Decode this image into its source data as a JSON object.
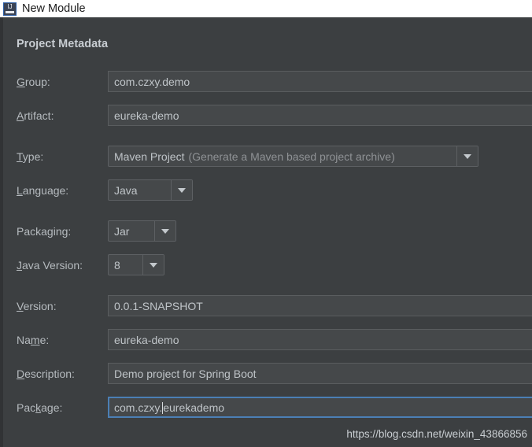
{
  "window": {
    "title": "New Module",
    "icon": "intellij-idea-icon",
    "icon_letters": "IJ"
  },
  "dialog": {
    "section_title": "Project Metadata",
    "fields": [
      {
        "id": "group",
        "kind": "text",
        "label_pre": "",
        "label_mnemonic": "G",
        "label_post": "roup:",
        "value": "com.czxy.demo",
        "focused": false
      },
      {
        "id": "artifact",
        "kind": "text",
        "label_pre": "",
        "label_mnemonic": "A",
        "label_post": "rtifact:",
        "value": "eureka-demo",
        "focused": false
      },
      {
        "id": "type",
        "kind": "combo",
        "label_pre": "",
        "label_mnemonic": "T",
        "label_post": "ype:",
        "value": "Maven Project",
        "value_dim": "(Generate a Maven based project archive)"
      },
      {
        "id": "language",
        "kind": "combo",
        "label_pre": "",
        "label_mnemonic": "L",
        "label_post": "anguage:",
        "value": "Java",
        "value_dim": ""
      },
      {
        "id": "packaging",
        "kind": "combo",
        "label_pre": "Packa",
        "label_mnemonic": "g",
        "label_post": "ing:",
        "value": "Jar",
        "value_dim": ""
      },
      {
        "id": "java-version",
        "kind": "combo",
        "label_pre": "",
        "label_mnemonic": "J",
        "label_post": "ava Version:",
        "value": "8",
        "value_dim": ""
      },
      {
        "id": "version",
        "kind": "text",
        "label_pre": "",
        "label_mnemonic": "V",
        "label_post": "ersion:",
        "value": "0.0.1-SNAPSHOT",
        "focused": false
      },
      {
        "id": "name",
        "kind": "text",
        "label_pre": "Na",
        "label_mnemonic": "m",
        "label_post": "e:",
        "value": "eureka-demo",
        "focused": false
      },
      {
        "id": "description",
        "kind": "text",
        "label_pre": "",
        "label_mnemonic": "D",
        "label_post": "escription:",
        "value": "Demo project for Spring Boot",
        "focused": false
      },
      {
        "id": "package",
        "kind": "text-caret",
        "label_pre": "Pac",
        "label_mnemonic": "k",
        "label_post": "age:",
        "value_before_caret": "com.czxy.",
        "value_after_caret": "eurekademo",
        "focused": true
      }
    ]
  },
  "watermark": {
    "text": "https://blog.csdn.net/weixin_43866856"
  },
  "colors": {
    "dialog_background": "#3c3f41",
    "field_background": "#45484a",
    "field_border": "#5a5d5f",
    "focus_border": "#4b7fb5",
    "label_text": "#b6bbbf",
    "value_text": "#bfc4c8",
    "dim_text": "#8f9295",
    "section_title_text": "#c8cdd2",
    "titlebar_background": "#ffffff",
    "titlebar_text": "#1c1c1c"
  }
}
